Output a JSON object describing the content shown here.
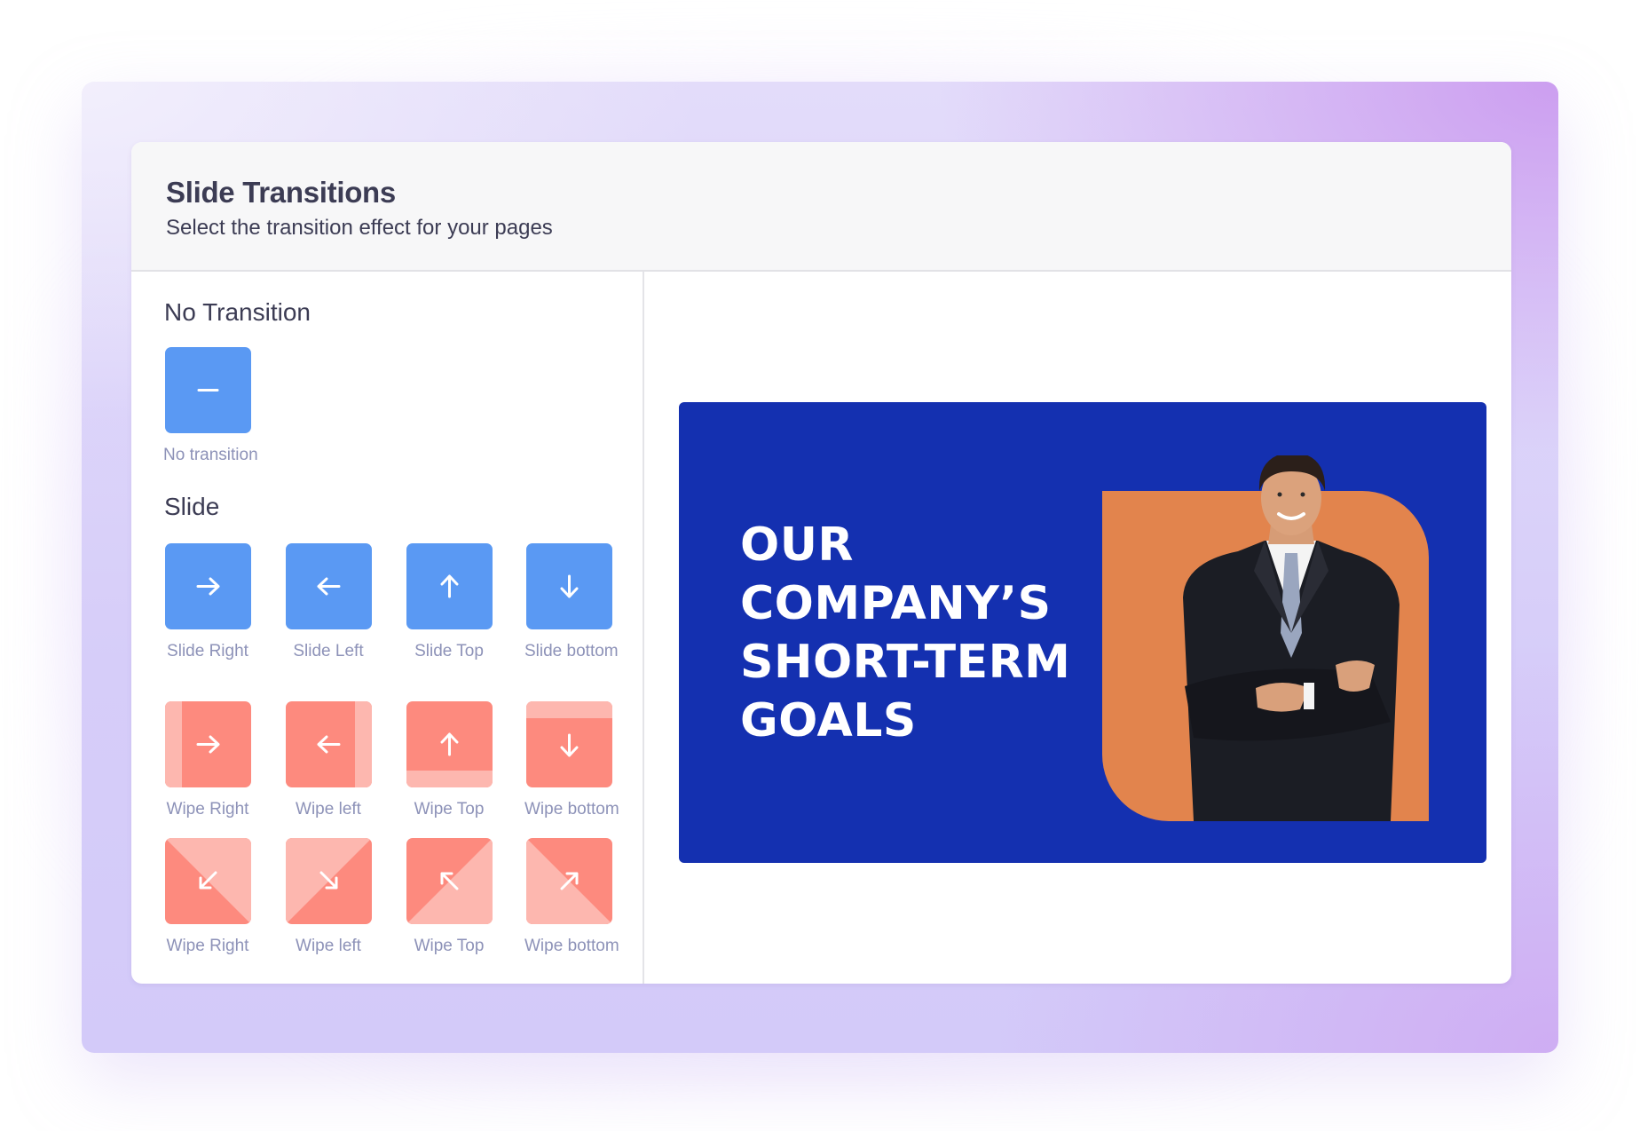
{
  "dialog": {
    "title": "Slide Transitions",
    "subtitle": "Select the transition effect for your pages"
  },
  "sections": {
    "no_transition": {
      "heading": "No Transition",
      "options": [
        {
          "label": "No transition",
          "icon": "minus-icon",
          "color": "#5a99f3"
        }
      ]
    },
    "slide": {
      "heading": "Slide",
      "options": [
        {
          "label": "Slide Right",
          "icon": "arrow-right-icon"
        },
        {
          "label": "Slide Left",
          "icon": "arrow-left-icon"
        },
        {
          "label": "Slide Top",
          "icon": "arrow-up-icon"
        },
        {
          "label": "Slide bottom",
          "icon": "arrow-down-icon"
        }
      ]
    },
    "wipe": {
      "options": [
        {
          "label": "Wipe Right",
          "icon": "arrow-right-icon"
        },
        {
          "label": "Wipe left",
          "icon": "arrow-left-icon"
        },
        {
          "label": "Wipe Top",
          "icon": "arrow-up-icon"
        },
        {
          "label": "Wipe bottom",
          "icon": "arrow-down-icon"
        }
      ]
    },
    "wipe_diagonal": {
      "options": [
        {
          "label": "Wipe Right",
          "icon": "arrow-down-left-icon"
        },
        {
          "label": "Wipe left",
          "icon": "arrow-down-right-icon"
        },
        {
          "label": "Wipe Top",
          "icon": "arrow-up-left-icon"
        },
        {
          "label": "Wipe bottom",
          "icon": "arrow-up-right-icon"
        }
      ]
    }
  },
  "preview": {
    "lines": [
      "OUR",
      "COMPANY’S",
      "SHORT-TERM",
      "GOALS"
    ],
    "background_color": "#1430b0",
    "accent_color": "#e2844d",
    "image": "businessman-photo"
  },
  "colors": {
    "slide_blue": "#5a99f3",
    "wipe_coral": "#fd8a7e",
    "wipe_coral_light": "#fdb7af",
    "label_gray": "#8d92b8",
    "heading_dark": "#3c3c54"
  }
}
